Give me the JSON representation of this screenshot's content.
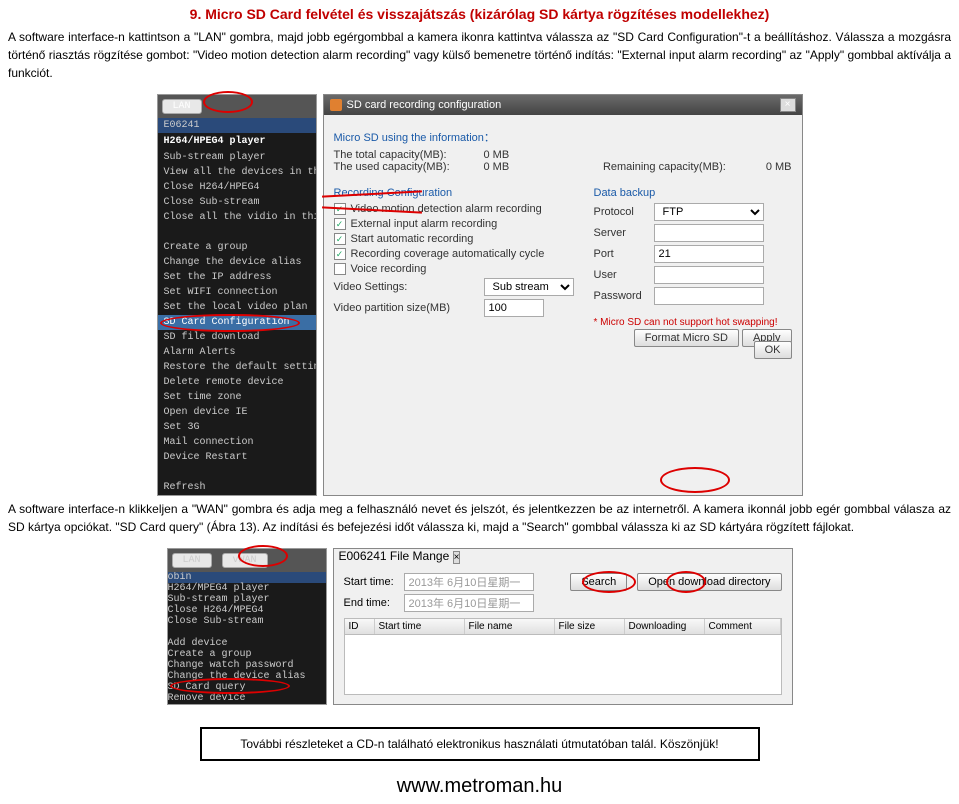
{
  "heading": "9. Micro SD Card felvétel és visszajátszás (kizárólag SD kártya rögzítéses modellekhez)",
  "para1": "A software interface-n kattintson a \"LAN\" gombra, majd jobb egérgombbal a kamera ikonra kattintva válassza az \"SD Card Configuration\"-t a beállításhoz. Válassza a mozgásra történő riasztás rögzítése gombot: \"Video motion detection alarm recording\" vagy külső bemenetre történő indítás: \"External input alarm recording\" az \"Apply\" gombbal aktíválja a funkciót.",
  "para2": "A software interface-n klikkeljen a \"WAN\" gombra és adja meg a felhasználó nevet és jelszót, és jelentkezzen be az internetről. A kamera ikonnál jobb egér gombbal válasza az SD kártya opciókat. \"SD Card query\" (Ábra 13). Az indítási és befejezési időt válassza ki, majd a \"Search\" gombbal válassza ki az SD kártyára rögzített fájlokat.",
  "footer": "További részleteket a CD-n található elektronikus használati útmutatóban talál. Köszönjük!",
  "url": "www.metroman.hu",
  "left1": {
    "lan": "LAN",
    "addr": "E06241",
    "hdr": "H264/HPEG4 player",
    "items": [
      "Sub-stream player",
      "View all the devices in this group",
      "Close H264/HPEG4",
      "Close Sub-stream",
      "Close all the vidio in this group",
      "",
      "Create a group",
      "Change the device alias",
      "Set the IP address",
      "Set WIFI connection",
      "Set the local video plan",
      "SD Card Configuration",
      "SD file download",
      "Alarm Alerts",
      "Restore the default setting",
      "Delete remote device",
      "Set time zone",
      "Open device IE",
      "Set 3G",
      "Mail connection",
      "Device Restart",
      "",
      "Refresh"
    ]
  },
  "dlg1": {
    "title": "SD card recording configuration",
    "info_hdr": "Micro SD using the information：",
    "total_lab": "The total capacity(MB):",
    "total_val": "0 MB",
    "used_lab": "The used capacity(MB):",
    "used_val": "0 MB",
    "remain_lab": "Remaining capacity(MB):",
    "remain_val": "0 MB",
    "rec_cfg": "Recording Configuration",
    "chk1": "Video motion detection alarm recording",
    "chk2": "External input alarm recording",
    "chk3": "Start automatic recording",
    "chk4": "Recording coverage automatically cycle",
    "chk5": "Voice recording",
    "vs_lab": "Video Settings:",
    "vs_val": "Sub stream",
    "vps_lab": "Video partition size(MB)",
    "vps_val": "100",
    "backup": "Data backup",
    "proto_lab": "Protocol",
    "proto_val": "FTP",
    "server_lab": "Server",
    "port_lab": "Port",
    "port_val": "21",
    "user_lab": "User",
    "pass_lab": "Password",
    "note": "* Micro SD can not support hot swapping!",
    "btn_format": "Format Micro SD",
    "btn_apply": "Apply",
    "btn_ok": "OK"
  },
  "left2": {
    "lan": "LAN",
    "wan": "vWAN",
    "id": "obin",
    "hdr": "H264/MPEG4 player",
    "items": [
      "Sub-stream player",
      "Close H264/MPEG4",
      "Close Sub-stream",
      "",
      "Add device",
      "Create a group",
      "Change watch password",
      "Change the device alias",
      "SD Card query",
      "Remove device"
    ]
  },
  "dlg2": {
    "title": "E006241 File Mange",
    "start_lab": "Start time:",
    "start_val": "2013年 6月10日星期一",
    "end_lab": "End time:",
    "end_val": "2013年 6月10日星期一",
    "search": "Search",
    "open": "Open download directory",
    "cols": [
      "ID",
      "Start time",
      "File name",
      "File size",
      "Downloading",
      "Comment"
    ]
  }
}
